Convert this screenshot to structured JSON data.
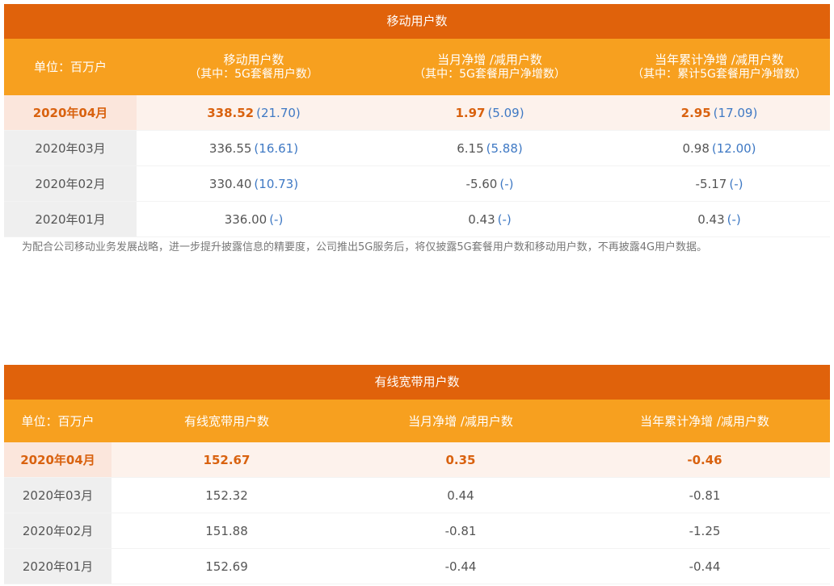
{
  "mobile": {
    "title": "移动用户数",
    "headers": [
      {
        "main": "单位：百万户",
        "sub": ""
      },
      {
        "main": "移动用户数",
        "sub": "（其中：5G套餐用户数）"
      },
      {
        "main": "当月净增 /减用户数",
        "sub": "（其中：5G套餐用户净增数）"
      },
      {
        "main": "当年累计净增 /减用户数",
        "sub": "（其中：累计5G套餐用户净增数）"
      }
    ],
    "rows": [
      {
        "label": "2020年04月",
        "c1": "338.52",
        "p1": "(21.70)",
        "c2": "1.97",
        "p2": "(5.09)",
        "c3": "2.95",
        "p3": "(17.09)"
      },
      {
        "label": "2020年03月",
        "c1": "336.55",
        "p1": "(16.61)",
        "c2": "6.15",
        "p2": "(5.88)",
        "c3": "0.98",
        "p3": "(12.00)"
      },
      {
        "label": "2020年02月",
        "c1": "330.40",
        "p1": "(10.73)",
        "c2": "-5.60",
        "p2": "(-)",
        "c3": "-5.17",
        "p3": "(-)"
      },
      {
        "label": "2020年01月",
        "c1": "336.00",
        "p1": "(-)",
        "c2": "0.43",
        "p2": "(-)",
        "c3": "0.43",
        "p3": "(-)"
      }
    ],
    "note": "为配合公司移动业务发展战略，进一步提升披露信息的精要度，公司推出5G服务后，将仅披露5G套餐用户数和移动用户数，不再披露4G用户数据。"
  },
  "broadband": {
    "title": "有线宽带用户数",
    "headers": [
      "单位：百万户",
      "有线宽带用户数",
      "当月净增 /减用户数",
      "当年累计净增 /减用户数"
    ],
    "rows": [
      {
        "label": "2020年04月",
        "c1": "152.67",
        "c2": "0.35",
        "c3": "-0.46"
      },
      {
        "label": "2020年03月",
        "c1": "152.32",
        "c2": "0.44",
        "c3": "-0.81"
      },
      {
        "label": "2020年02月",
        "c1": "151.88",
        "c2": "-0.81",
        "c3": "-1.25"
      },
      {
        "label": "2020年01月",
        "c1": "152.69",
        "c2": "-0.44",
        "c3": "-0.44"
      }
    ]
  },
  "colors": {
    "title_bg": "#e0620b",
    "header_bg": "#f7a01f",
    "highlight_text": "#d9620f",
    "paren_text": "#3f79c4"
  }
}
